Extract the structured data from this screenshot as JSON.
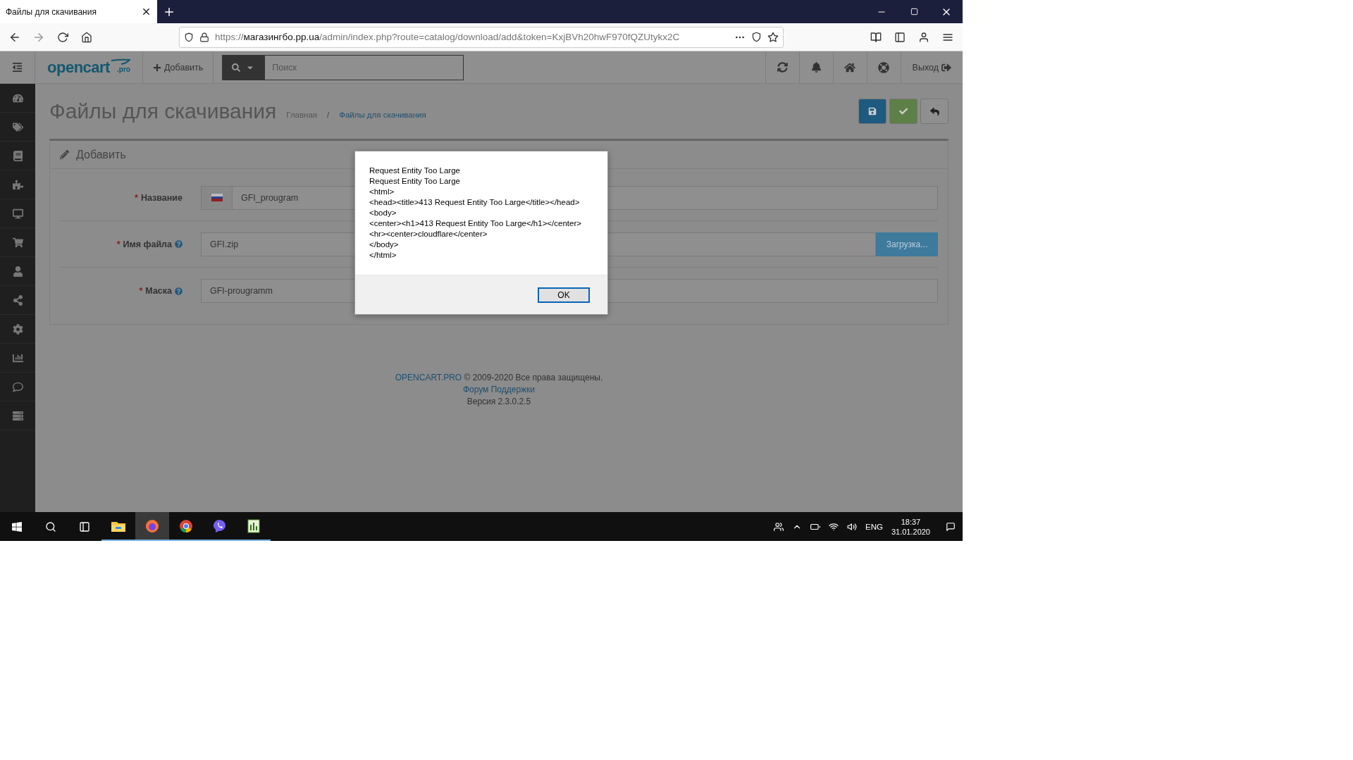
{
  "browser": {
    "tab_title": "Файлы для скачивания",
    "url": {
      "scheme": "https://",
      "host": "магазингбо.pp.ua",
      "path": "/admin/index.php?route=catalog/download/add&token=KxjBVh20hwF970fQZUtykx2C"
    }
  },
  "header": {
    "logo": "opencart",
    "logo_suffix": ".pro",
    "add_label": "Добавить",
    "search": {
      "placeholder": "Поиск"
    },
    "logout_label": "Выход"
  },
  "page": {
    "title": "Файлы для скачивания",
    "separator": "/",
    "breadcrumbs": [
      {
        "label": "Главная",
        "selected": false
      },
      {
        "label": "Файлы для скачивания",
        "selected": true
      }
    ]
  },
  "panel": {
    "title": "Добавить",
    "fields": [
      {
        "label": "Название",
        "required_mark": "*",
        "help": false,
        "kind": "flag",
        "value": "GFI_prougram"
      },
      {
        "label": "Имя файла",
        "required_mark": "*",
        "help": true,
        "kind": "upload",
        "value": "GFI.zip",
        "button": "Загрузка..."
      },
      {
        "label": "Маска",
        "required_mark": "*",
        "help": true,
        "kind": "plain",
        "value": "GFI-prougramm"
      }
    ]
  },
  "footer": {
    "brand": "OPENCART.PRO",
    "copyright": "© 2009-2020 Все права защищены.",
    "forum": "Форум Поддержки",
    "version": "Версия 2.3.0.2.5"
  },
  "dialog": {
    "lines": [
      "Request Entity Too Large",
      "Request Entity Too Large",
      "<html>",
      "<head><title>413 Request Entity Too Large</title></head>",
      "<body>",
      "<center><h1>413 Request Entity Too Large</h1></center>",
      "<hr><center>cloudflare</center>",
      "</body>",
      "</html>"
    ],
    "button": "OK"
  },
  "taskbar": {
    "apps": [
      {
        "kind": "explorer",
        "selected": false
      },
      {
        "kind": "firefox",
        "selected": true
      },
      {
        "kind": "chrome",
        "selected": false
      },
      {
        "kind": "viber",
        "selected": false
      },
      {
        "kind": "sheet",
        "selected": false
      }
    ],
    "language": "ENG",
    "time": "18:37",
    "date": "31.01.2020"
  }
}
